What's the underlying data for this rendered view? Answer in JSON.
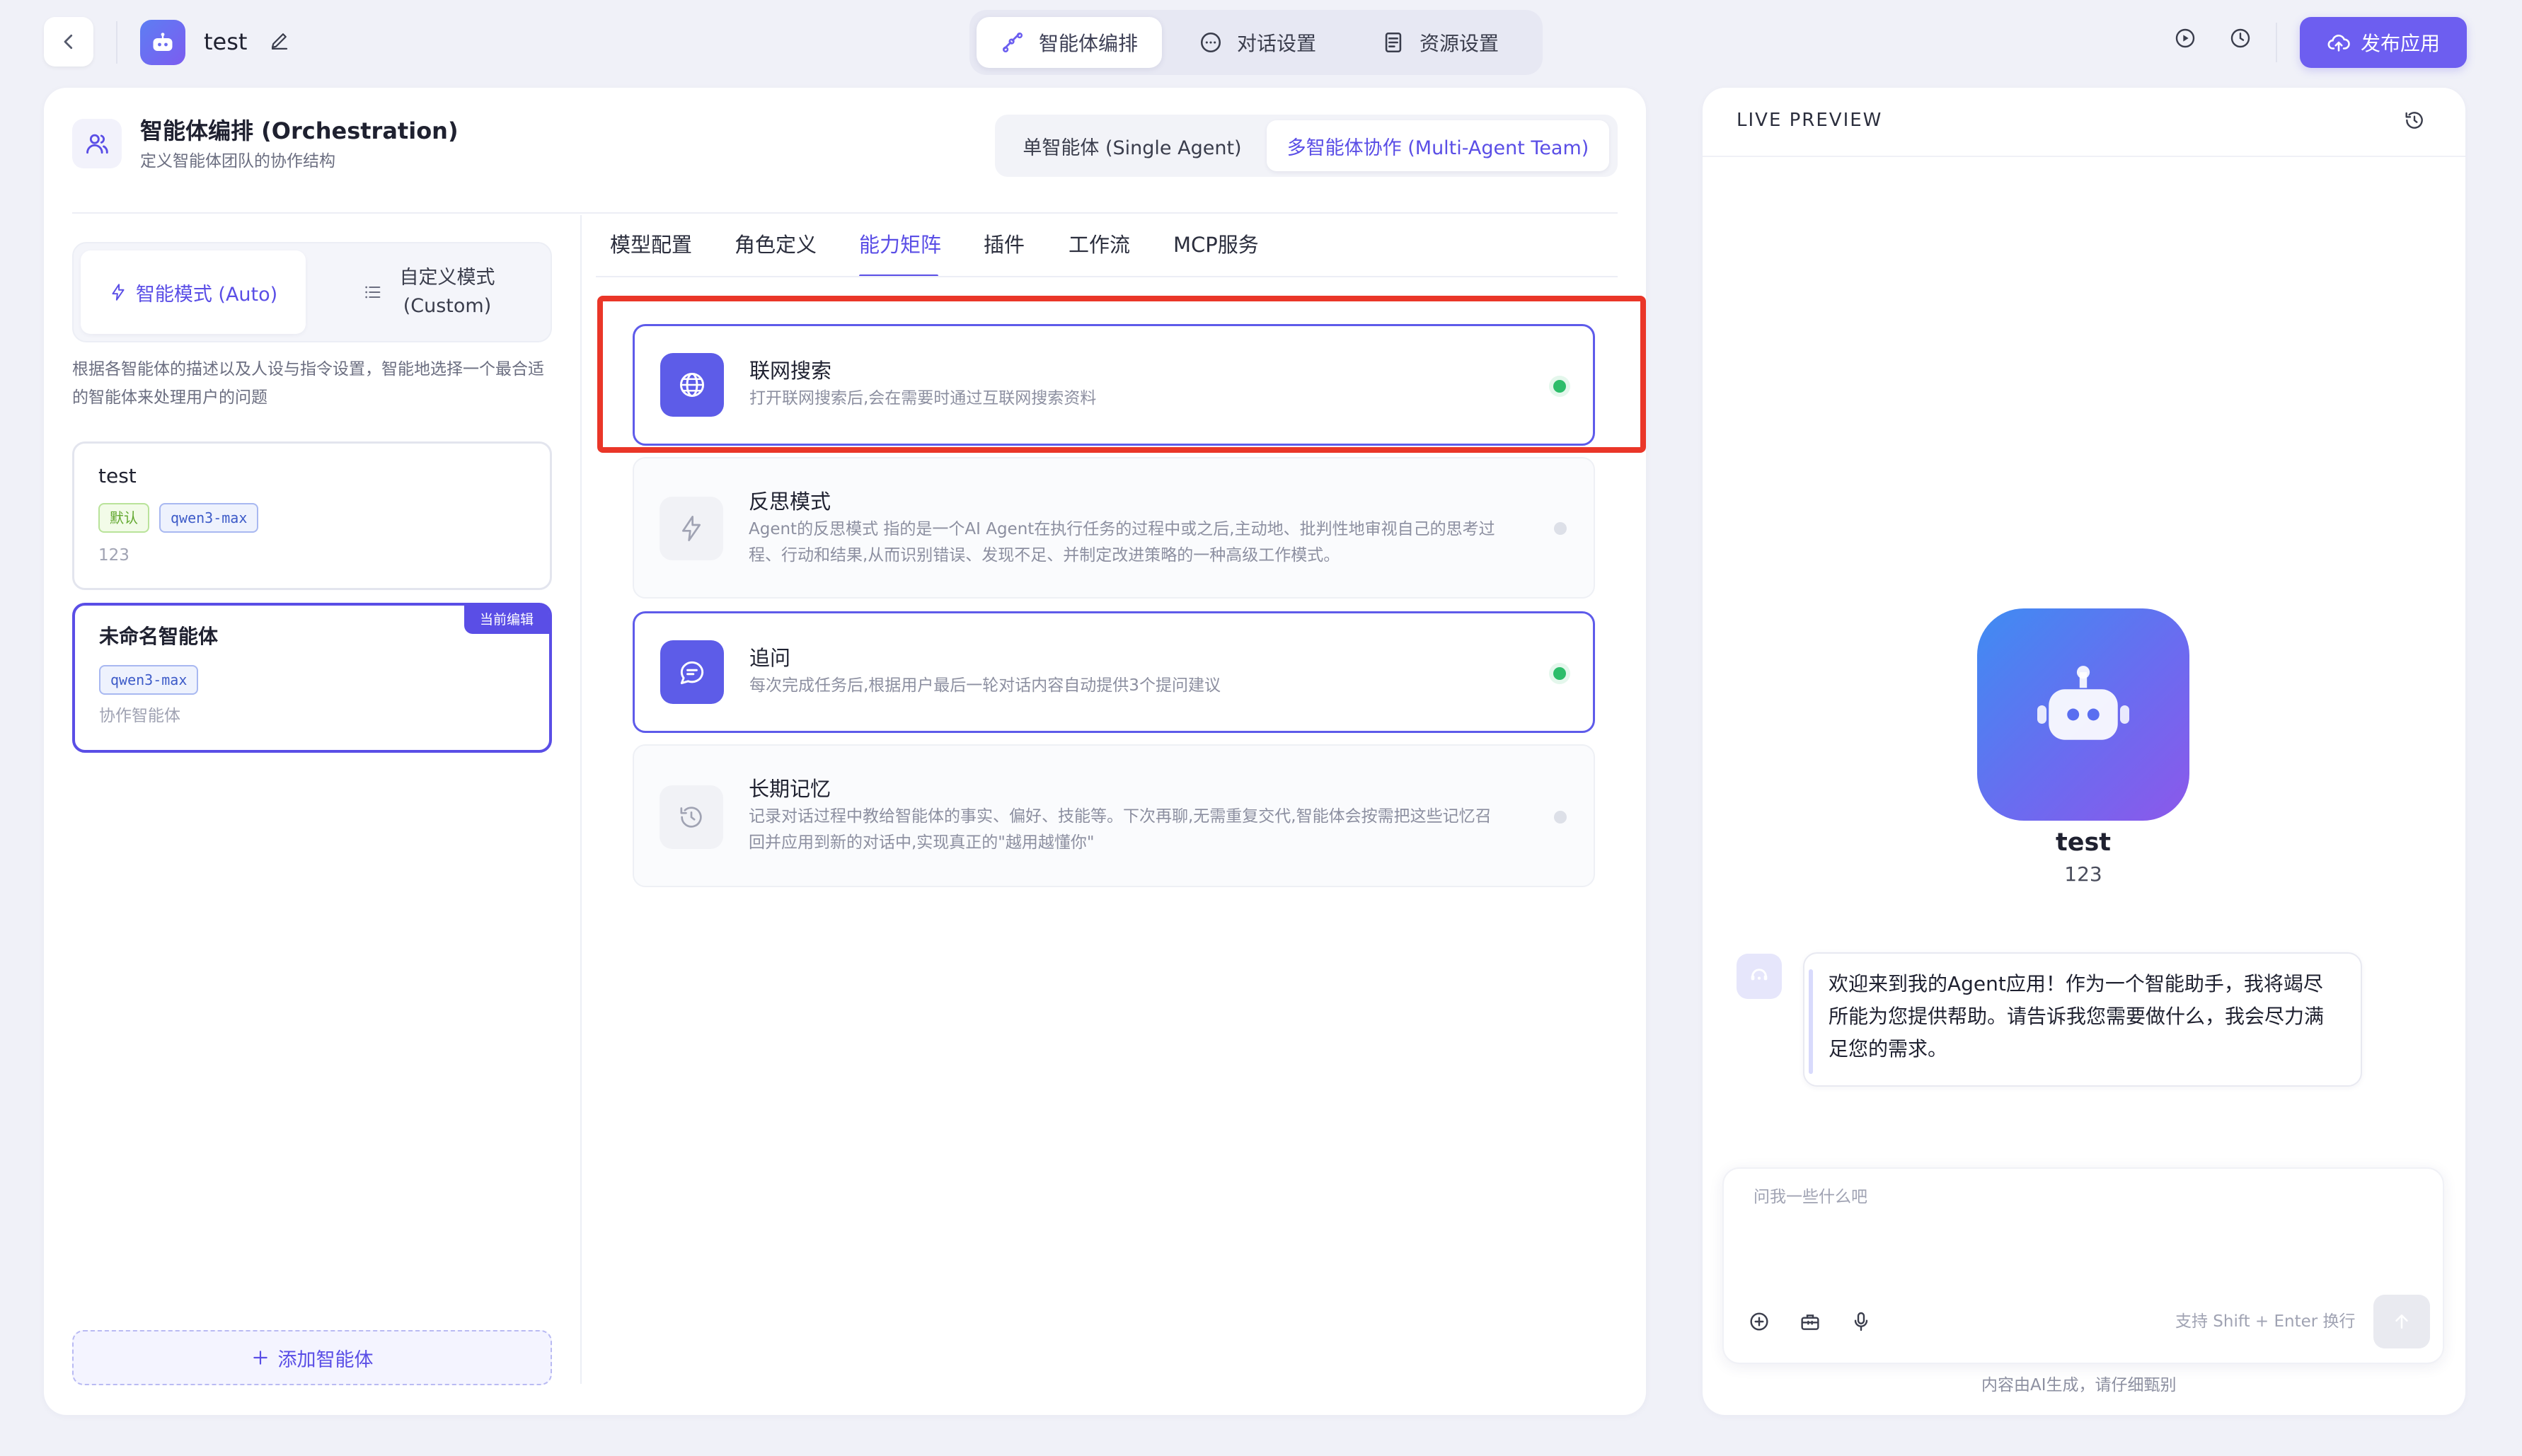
{
  "header": {
    "app_name": "test",
    "tabs": [
      {
        "label": "智能体编排",
        "active": true
      },
      {
        "label": "对话设置",
        "active": false
      },
      {
        "label": "资源设置",
        "active": false
      }
    ],
    "publish_label": "发布应用",
    "accent_color": "#6d5ef0"
  },
  "orchestration": {
    "title": "智能体编排 (Orchestration)",
    "subtitle": "定义智能体团队的协作结构",
    "agent_modes": [
      {
        "label": "单智能体 (Single Agent)",
        "active": false
      },
      {
        "label": "多智能体协作 (Multi-Agent Team)",
        "active": true
      }
    ]
  },
  "team_mode": {
    "auto_label": "智能模式 (Auto)",
    "custom_label_line1": "自定义模式",
    "custom_label_line2": "(Custom)",
    "description": "根据各智能体的描述以及人设与指令设置，智能地选择一个最合适的智能体来处理用户的问题"
  },
  "agents": [
    {
      "name": "test",
      "tags": [
        "默认",
        "qwen3-max"
      ],
      "description": "123",
      "current": false
    },
    {
      "name": "未命名智能体",
      "tags": [
        "qwen3-max"
      ],
      "description": "协作智能体",
      "current": true,
      "badge": "当前编辑"
    }
  ],
  "add_agent_label": "添加智能体",
  "config_tabs": [
    "模型配置",
    "角色定义",
    "能力矩阵",
    "插件",
    "工作流",
    "MCP服务"
  ],
  "active_config_tab": "能力矩阵",
  "capabilities": [
    {
      "title": "联网搜索",
      "description": "打开联网搜索后,会在需要时通过互联网搜索资料",
      "enabled": true,
      "icon": "globe-icon"
    },
    {
      "title": "反思模式",
      "description_line1": "Agent的反思模式 指的是一个AI Agent在执行任务的过程中或之后,主动地、批判性地审视自己的思考过",
      "description_line2": "程、行动和结果,从而识别错误、发现不足、并制定改进策略的一种高级工作模式。",
      "enabled": false,
      "icon": "lightning-icon"
    },
    {
      "title": "追问",
      "description": "每次完成任务后,根据用户最后一轮对话内容自动提供3个提问建议",
      "enabled": true,
      "icon": "chat-icon"
    },
    {
      "title": "长期记忆",
      "description_line1": "记录对话过程中教给智能体的事实、偏好、技能等。下次再聊,无需重复交代,智能体会按需把这些记忆召",
      "description_line2": "回并应用到新的对话中,实现真正的\"越用越懂你\"",
      "enabled": false,
      "icon": "history-icon"
    }
  ],
  "preview": {
    "label": "LIVE PREVIEW",
    "bot_name": "test",
    "bot_description": "123",
    "welcome_message": "欢迎来到我的Agent应用！作为一个智能助手，我将竭尽所能为您提供帮助。请告诉我您需要做什么，我会尽力满足您的需求。",
    "input_placeholder": "问我一些什么吧",
    "input_hint": "支持 Shift + Enter 换行",
    "footnote": "内容由AI生成，请仔细甄别"
  }
}
